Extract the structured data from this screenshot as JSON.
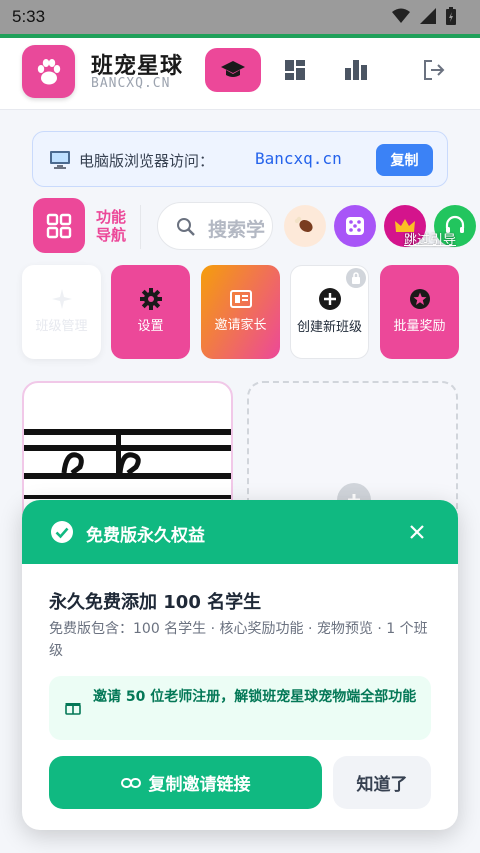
{
  "status_bar": {
    "time": "5:33"
  },
  "header": {
    "brand_title": "班宠星球",
    "brand_subtitle": "BANCXQ.CN"
  },
  "banner": {
    "text": "电脑版浏览器访问：",
    "url": "Bancxq.cn",
    "copy_label": "复制"
  },
  "toolbar": {
    "function_nav_label": "功能导航",
    "search_placeholder": "搜索学",
    "skip_guide": "跳过引导"
  },
  "tiles": {
    "ghost_label": "班级管理",
    "settings": "设置",
    "invite_parents": "邀请家长",
    "create_class": "创建新班级",
    "bulk_reward": "批量奖励"
  },
  "modal": {
    "title": "免费版永久权益",
    "headline": "永久免费添加 100 名学生",
    "description": "免费版包含：100 名学生 · 核心奖励功能 · 宠物预览 · 1 个班级",
    "tip": "邀请 50 位老师注册，解锁班宠星球宠物端全部功能",
    "primary_button": "复制邀请链接",
    "secondary_button": "知道了"
  },
  "colors": {
    "brand_pink": "#ec4899",
    "accent_green": "#10b981",
    "link_blue": "#2563eb"
  }
}
